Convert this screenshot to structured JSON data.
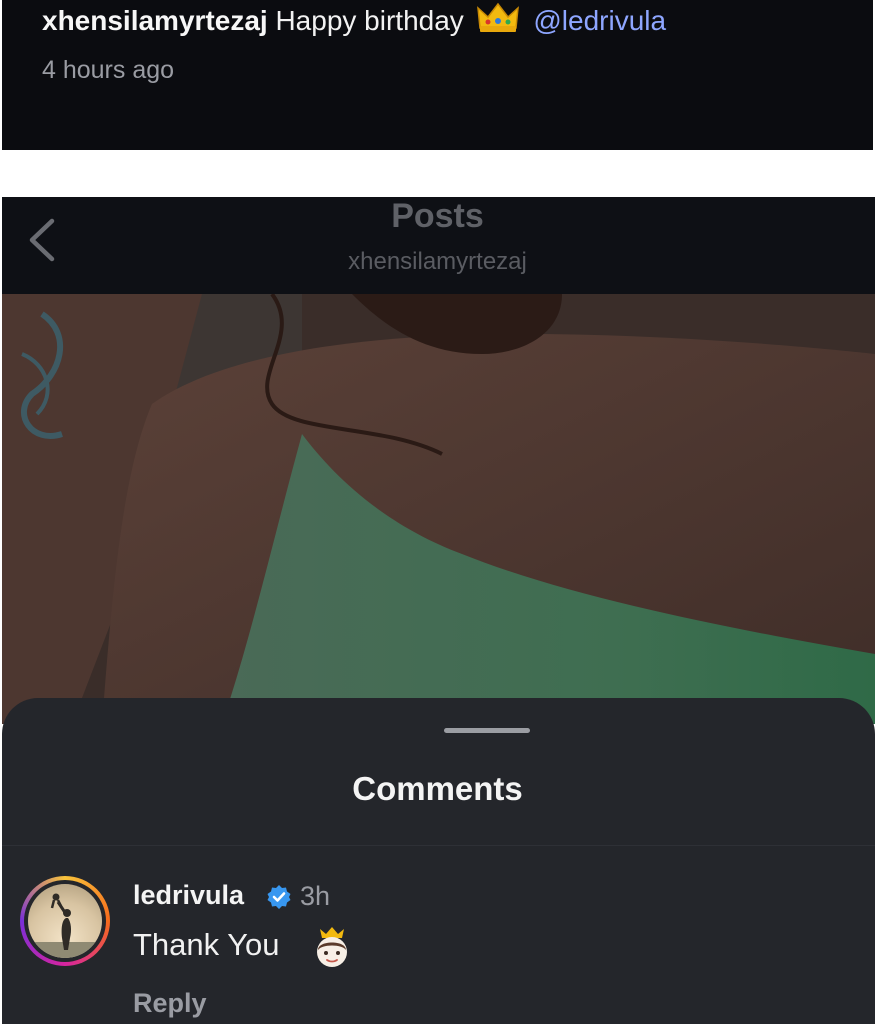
{
  "caption": {
    "username": "xhensilamyrtezaj",
    "text": "Happy birthday",
    "emoji_icon": "crown-icon",
    "mention": "@ledrivula",
    "time": "4 hours ago"
  },
  "header": {
    "title": "Posts",
    "subtitle": "xhensilamyrtezaj",
    "back_icon": "chevron-left-icon"
  },
  "sheet": {
    "title": "Comments"
  },
  "comment": {
    "username": "ledrivula",
    "verified": true,
    "time": "3h",
    "text": "Thank You",
    "emoji_icon": "princess-emoji-icon",
    "reply_label": "Reply"
  },
  "colors": {
    "mention": "#8ea6ff",
    "verified": "#3897f0",
    "sheet_bg": "#24262b",
    "header_bg": "#0e1015"
  }
}
